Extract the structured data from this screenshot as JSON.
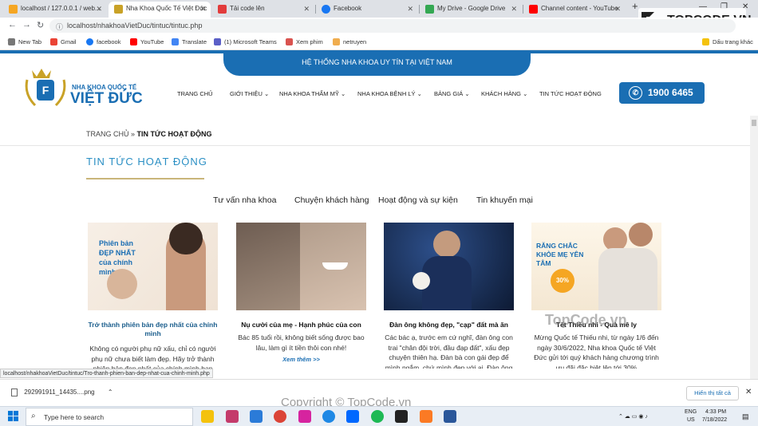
{
  "browser": {
    "tabs": [
      {
        "label": "localhost / 127.0.0.1 / web...",
        "icon": "phpmyadmin-icon",
        "color": "#f5a623"
      },
      {
        "label": "Nha Khoa Quốc Tế Việt Đức",
        "icon": "site-icon",
        "color": "#c9a227"
      },
      {
        "label": "Tải code lên",
        "icon": "upload-icon",
        "color": "#e23b3b"
      },
      {
        "label": "Facebook",
        "icon": "facebook-icon",
        "color": "#1877f2"
      },
      {
        "label": "My Drive - Google Drive",
        "icon": "drive-icon",
        "color": "#34a853"
      },
      {
        "label": "Channel content - YouTube",
        "icon": "youtube-icon",
        "color": "#ff0000"
      }
    ],
    "url": "localhost/nhakhoaVietDuc/tintuc/tintuc.php",
    "bookmarks": [
      {
        "label": "New Tab",
        "color": "#555"
      },
      {
        "label": "Gmail",
        "color": "#ea4335"
      },
      {
        "label": "facebook",
        "color": "#1877f2"
      },
      {
        "label": "YouTube",
        "color": "#ff0000"
      },
      {
        "label": "Translate",
        "color": "#4285f4"
      },
      {
        "label": "(1) Microsoft Teams",
        "color": "#5b5fc7"
      },
      {
        "label": "Xem phim",
        "color": "#d9534f"
      },
      {
        "label": "netruyen",
        "color": "#f0ad4e"
      }
    ],
    "other_bookmarks": "Dấu trang khác",
    "status_url": "localhost/nhakhoaVietDuc/tintuc/Tro-thanh-phien-ban-dep-nhat-cua-chinh-minh.php"
  },
  "site": {
    "top_banner": "HỆ THỐNG NHA KHOA UY TÍN TẠI VIỆT NAM",
    "logo_line1": "NHA KHOA QUỐC TẾ",
    "logo_line2": "VIỆT ĐỨC",
    "menu": [
      "TRANG CHỦ",
      "GIỚI THIỆU",
      "NHA KHOA THẨM MỸ",
      "NHA KHOA BỆNH LÝ",
      "BẢNG GIÁ",
      "KHÁCH HÀNG",
      "TIN TỨC HOẠT ĐỘNG"
    ],
    "hotline": "1900 6465",
    "brand_color": "#1a6eb3"
  },
  "page": {
    "breadcrumb_home": "TRANG CHỦ",
    "breadcrumb_sep": "»",
    "breadcrumb_current": "TIN TỨC HOẠT ĐỘNG",
    "title": "TIN TỨC HOẠT ĐỘNG",
    "categories": [
      "Tư vấn nha khoa",
      "Chuyện khách hàng",
      "Hoạt động và sự kiện",
      "Tin khuyến mại"
    ],
    "articles": [
      {
        "title": "Trở thành phiên bản đẹp nhất của chính mình",
        "desc": "Không có người phụ nữ xấu, chỉ có người phụ nữ chưa biết làm đẹp. Hãy trở thành phiên bản đẹp nhất của chính mình bạn",
        "img_text": "Phiên bản ĐẸP NHẤT của chính mình"
      },
      {
        "title": "Nụ cười của mẹ - Hạnh phúc của con",
        "desc": "Bác 85 tuổi rồi, không biết sống được bao lâu, làm gì ít tiền thôi con nhé!",
        "more": "Xem thêm >>"
      },
      {
        "title": "Đàn ông không đẹp, \"cạp\" đất mà ăn",
        "desc": "Các bác ạ, trước em cứ nghĩ, đàn ông con trai \"chân đội trời, đầu đạp đất\", xấu đẹp chuyện thiên hạ. Đàn bà con gái đẹp để mình ngắm, chứ mình đẹp với ai. Đàn ông"
      },
      {
        "title": "Tết Thiếu nhi - Quà mê ly",
        "desc": "Mừng Quốc tế Thiếu nhi, từ ngày 1/6 đến ngày 30/6/2022, Nha khoa Quốc tế Việt Đức gửi tới quý khách hàng chương trình ưu đãi đặc biệt lên tới 30%",
        "img_text": "RĂNG CHẮC KHỎE MẸ YÊN TÂM",
        "badge": "30%"
      }
    ]
  },
  "downloads": {
    "file": "292991911_14435....png",
    "show_all": "Hiển thị tất cả"
  },
  "taskbar": {
    "search_placeholder": "Type here to search",
    "lang1": "ENG",
    "lang2": "US",
    "time": "4:33 PM",
    "date": "7/18/2022"
  },
  "watermark": {
    "brand": "TOPCODE.VN",
    "center": "TopCode.vn",
    "copyright": "Copyright © TopCode.vn"
  }
}
